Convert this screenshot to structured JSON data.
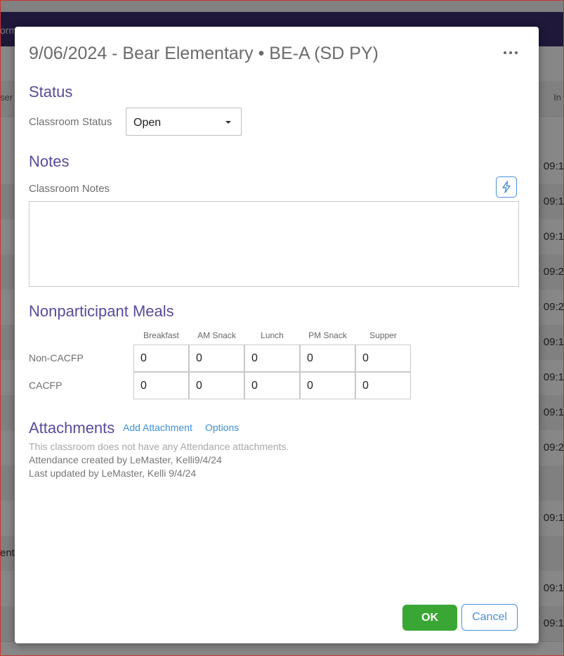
{
  "background": {
    "nav_fragment": "orm",
    "col_left": "ser",
    "col_right": "In",
    "rows": [
      {
        "time": "09:1",
        "alt": false
      },
      {
        "time": "09:1",
        "alt": true
      },
      {
        "time": "09:1",
        "alt": false
      },
      {
        "time": "09:2",
        "alt": true
      },
      {
        "time": "09:2",
        "alt": false
      },
      {
        "time": "09:1",
        "alt": true
      },
      {
        "time": "09:1",
        "alt": false
      },
      {
        "time": "09:1",
        "alt": true
      },
      {
        "time": "09:2",
        "alt": false
      },
      {
        "time": "",
        "alt": true
      },
      {
        "time": "09:1",
        "alt": false
      },
      {
        "time": "",
        "alt": true,
        "left": "ent"
      },
      {
        "time": "09:1",
        "alt": false
      },
      {
        "time": "09:1",
        "alt": true
      }
    ]
  },
  "modal": {
    "title": "9/06/2024 - Bear Elementary • BE-A (SD PY)",
    "more_icon": "ellipsis-icon",
    "status": {
      "section_title": "Status",
      "classroom_status_label": "Classroom Status",
      "classroom_status_value": "Open"
    },
    "notes": {
      "section_title": "Notes",
      "classroom_notes_label": "Classroom Notes",
      "classroom_notes_value": "",
      "quick_text_icon": "lightning-icon"
    },
    "meals": {
      "section_title": "Nonparticipant Meals",
      "columns": [
        "Breakfast",
        "AM Snack",
        "Lunch",
        "PM Snack",
        "Supper"
      ],
      "rows": [
        {
          "label": "Non-CACFP",
          "values": [
            "0",
            "0",
            "0",
            "0",
            "0"
          ]
        },
        {
          "label": "CACFP",
          "values": [
            "0",
            "0",
            "0",
            "0",
            "0"
          ]
        }
      ]
    },
    "attachments": {
      "section_title": "Attachments",
      "add_link": "Add Attachment",
      "options_link": "Options",
      "empty_text": "This classroom does not have any Attendance attachments.",
      "created_text": "Attendance created by LeMaster, Kelli9/4/24",
      "updated_text": "Last updated by LeMaster, Kelli 9/4/24"
    },
    "ok_label": "OK",
    "cancel_label": "Cancel",
    "accent_color": "#5a4a9c",
    "ok_color": "#3aa735",
    "link_color": "#3d8fd6"
  }
}
